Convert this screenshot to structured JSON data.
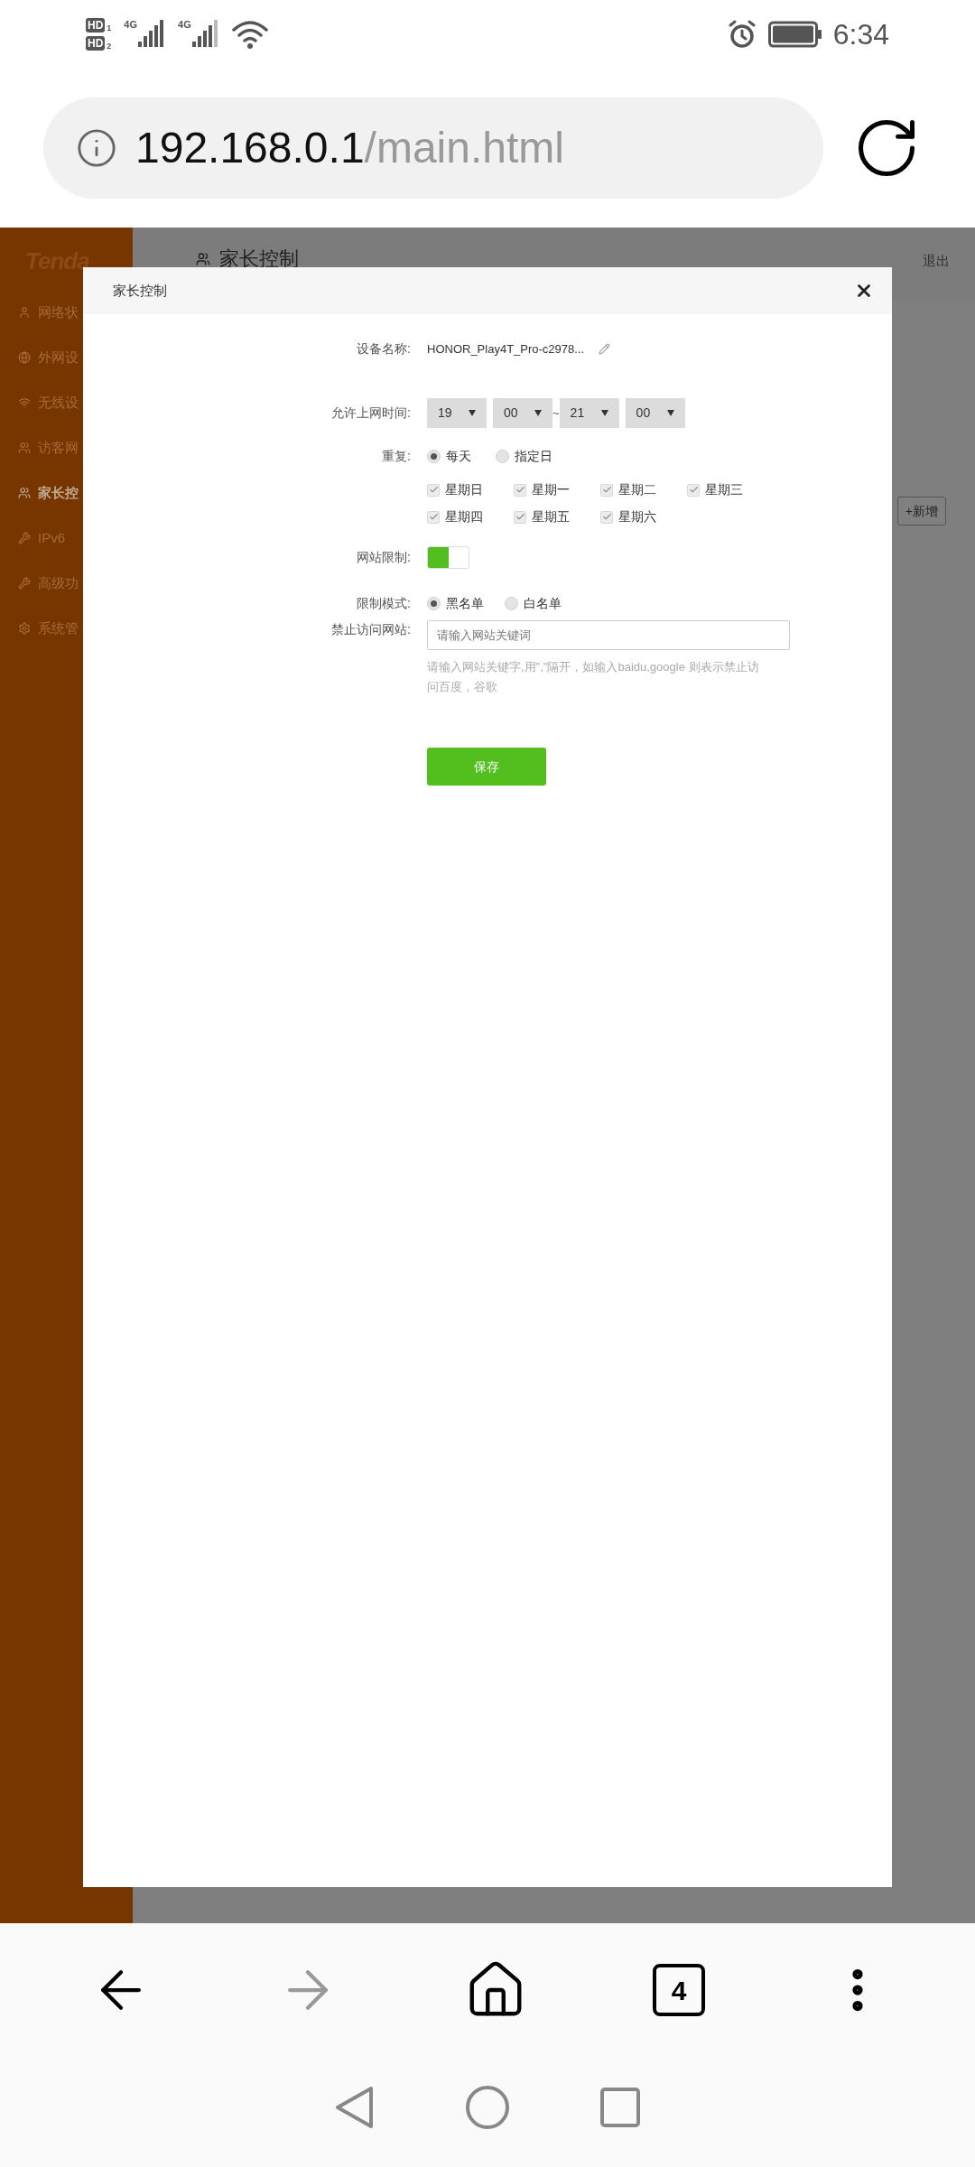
{
  "status_bar": {
    "sims": [
      {
        "badge": "HD",
        "slot": "1",
        "network": "4G"
      },
      {
        "badge": "HD",
        "slot": "2",
        "network": "4G"
      }
    ],
    "time": "6:34"
  },
  "address_bar": {
    "host": "192.168.0.1",
    "path": "/main.html"
  },
  "sidebar": {
    "logo": "Tenda",
    "items": [
      {
        "label": "网络状",
        "selected": false
      },
      {
        "label": "外网设",
        "selected": false
      },
      {
        "label": "无线设",
        "selected": false
      },
      {
        "label": "访客网",
        "selected": false
      },
      {
        "label": "家长控",
        "selected": true
      },
      {
        "label": "IPv6",
        "selected": false
      },
      {
        "label": "高级功",
        "selected": false
      },
      {
        "label": "系统管",
        "selected": false
      }
    ]
  },
  "page_header": {
    "title": "家长控制",
    "logout": "退出"
  },
  "add_button": "+新增",
  "dialog": {
    "title": "家长控制",
    "device_name": {
      "label": "设备名称:",
      "value": "HONOR_Play4T_Pro-c2978..."
    },
    "time": {
      "label": "允许上网时间:",
      "selects": [
        "19",
        "00",
        "21",
        "00"
      ],
      "separator": "~"
    },
    "repeat": {
      "label": "重复:",
      "options": [
        {
          "label": "每天",
          "selected": true
        },
        {
          "label": "指定日",
          "selected": false
        }
      ],
      "days": [
        {
          "label": "星期日",
          "checked": true,
          "disabled": true
        },
        {
          "label": "星期一",
          "checked": true,
          "disabled": true
        },
        {
          "label": "星期二",
          "checked": true,
          "disabled": true
        },
        {
          "label": "星期三",
          "checked": true,
          "disabled": true
        },
        {
          "label": "星期四",
          "checked": true,
          "disabled": true
        },
        {
          "label": "星期五",
          "checked": true,
          "disabled": true
        },
        {
          "label": "星期六",
          "checked": true,
          "disabled": true
        }
      ]
    },
    "site_restriction": {
      "label": "网站限制:",
      "on": true
    },
    "mode": {
      "label": "限制模式:",
      "options": [
        {
          "label": "黑名单",
          "selected": true
        },
        {
          "label": "白名单",
          "selected": false
        }
      ]
    },
    "blocked_sites": {
      "label": "禁止访问网站:",
      "placeholder": "请输入网站关键词",
      "hint": "请输入网站关键字,用\",\"隔开，如输入baidu,google 则表示禁止访问百度，谷歌"
    },
    "save": "保存"
  },
  "browser_toolbar": {
    "tab_count": "4",
    "forward_disabled": true
  }
}
